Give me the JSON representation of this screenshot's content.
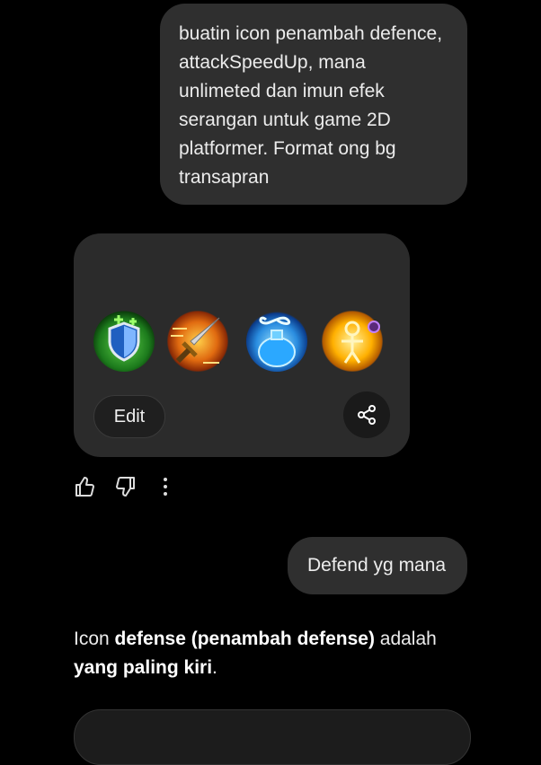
{
  "messages": {
    "user_prompt": "buatin icon penambah defence, attackSpeedUp, mana unlimeted dan imun efek serangan untuk game 2D platformer. Format ong bg transapran",
    "user_followup": "Defend yg mana"
  },
  "image_card": {
    "icons": [
      "shield-plus-icon",
      "sword-speed-icon",
      "mana-potion-infinity-icon",
      "immune-aura-icon"
    ],
    "edit_label": "Edit"
  },
  "reply_actions": [
    "thumbs-up-icon",
    "thumbs-down-icon",
    "more-vertical-icon"
  ],
  "answer": {
    "part1": "Icon ",
    "bold1": "defense (penambah defense)",
    "part2": " adalah ",
    "bold2": "yang paling kiri",
    "part3": "."
  }
}
